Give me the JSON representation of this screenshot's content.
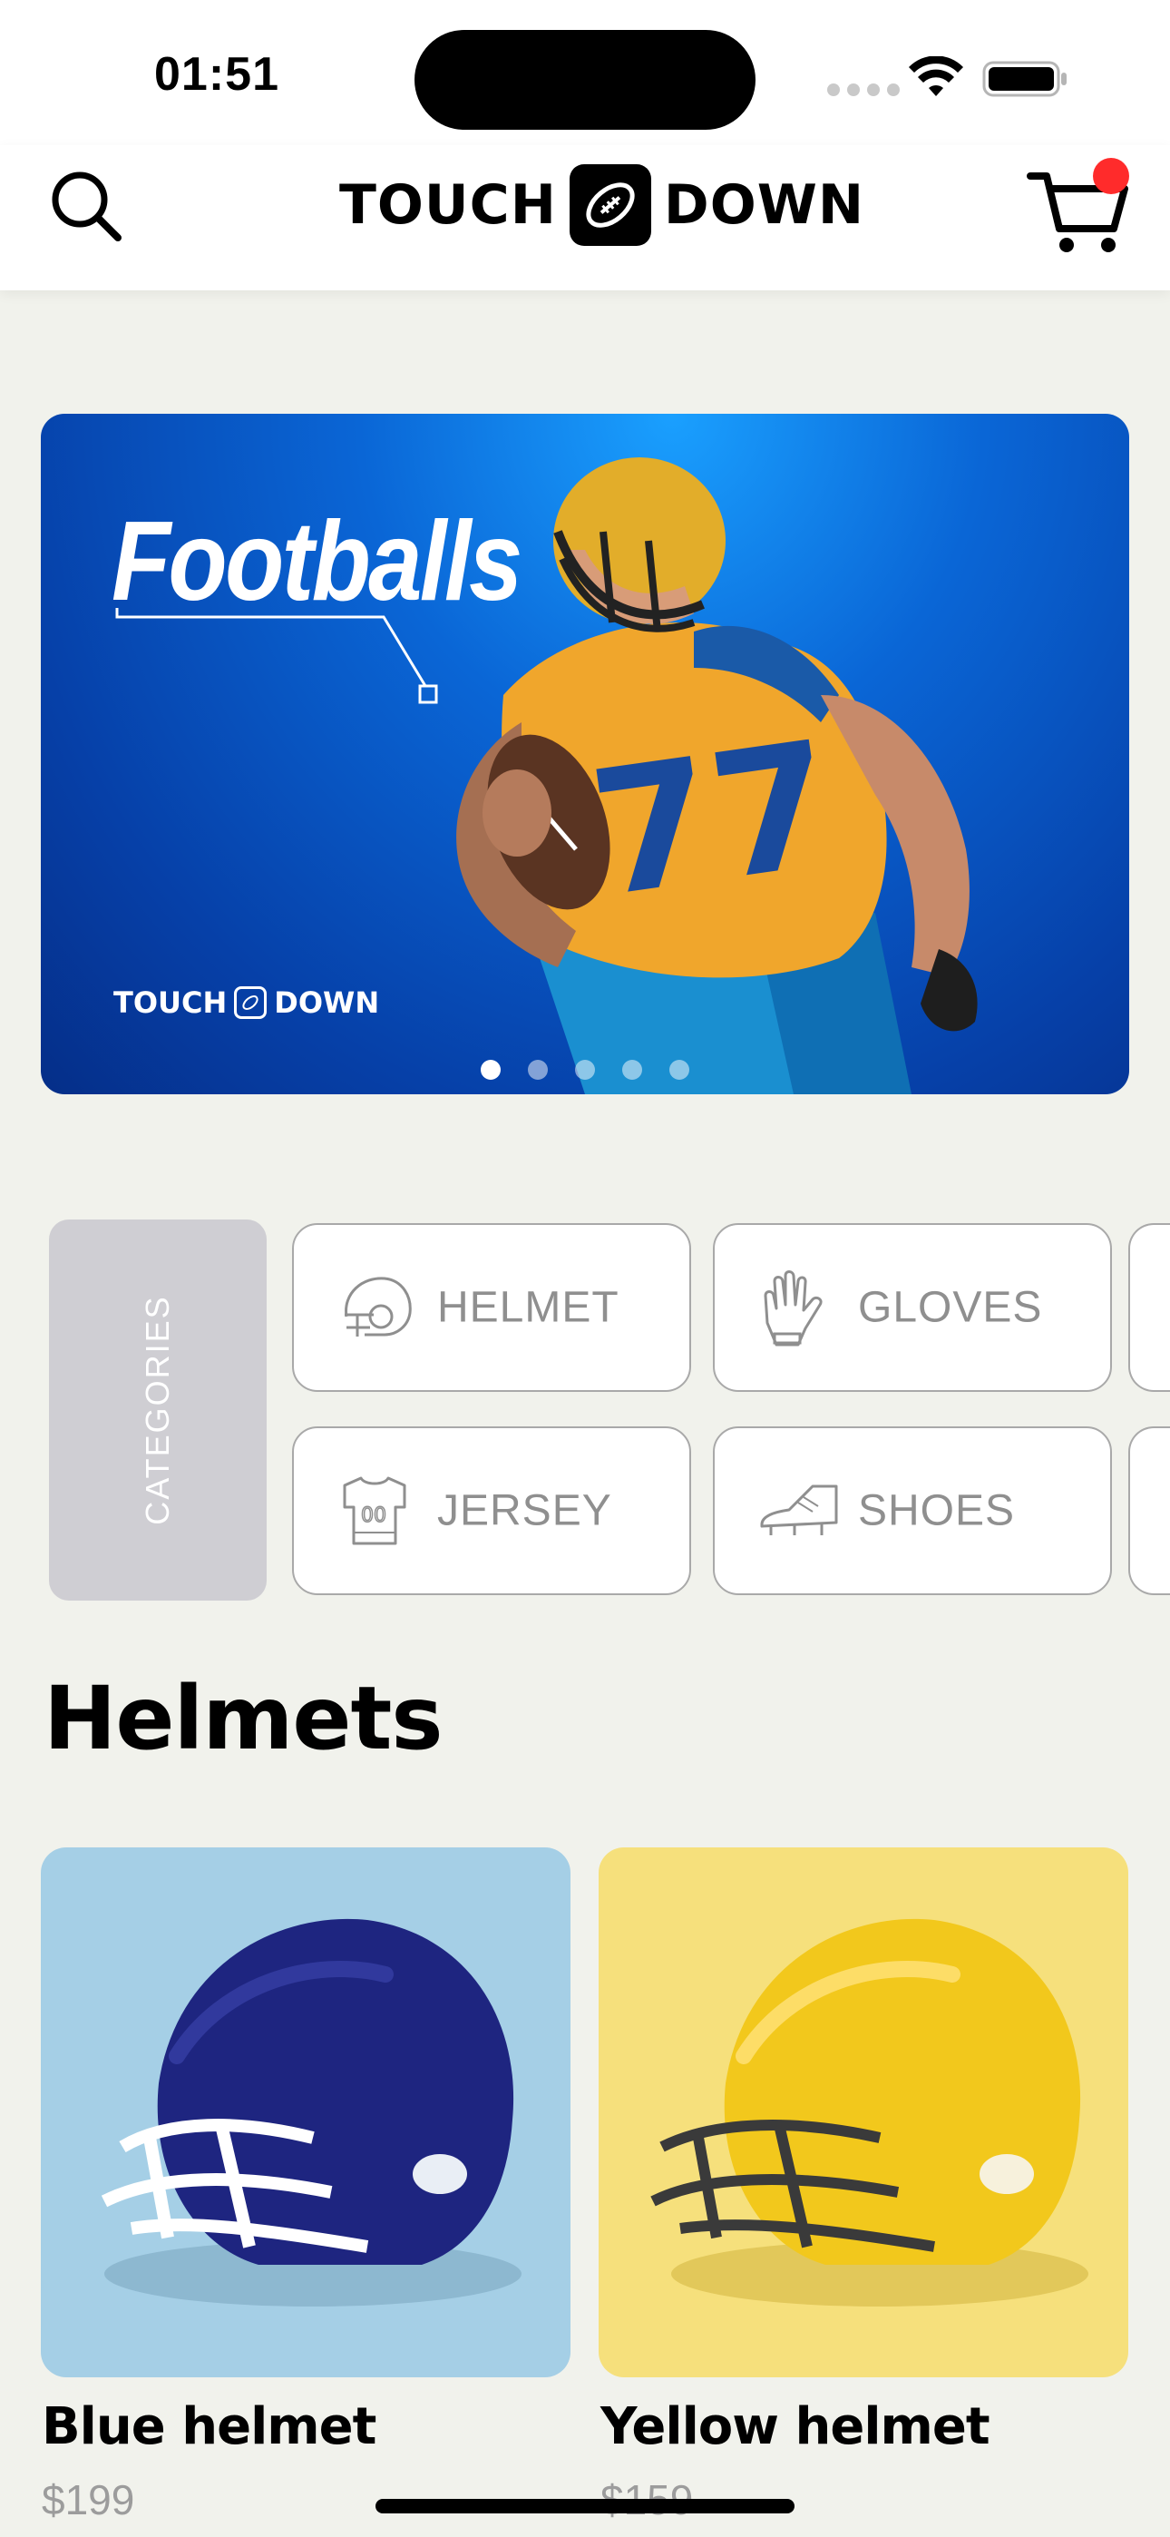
{
  "status_bar": {
    "time": "01:51"
  },
  "header": {
    "logo_left": "TOUCH",
    "logo_right": "DOWN",
    "search_icon": "search-icon",
    "cart_icon": "cart-icon",
    "cart_badge_color": "#ff2b2b"
  },
  "hero": {
    "title": "Footballs",
    "brand_left": "TOUCH",
    "brand_right": "DOWN",
    "slide_count": 5,
    "active_slide": 1,
    "background_color": "#0a66d6"
  },
  "categories": {
    "label": "CATEGORIES",
    "items": [
      {
        "label": "HELMET",
        "icon": "helmet-icon"
      },
      {
        "label": "GLOVES",
        "icon": "gloves-icon"
      },
      {
        "label": "JERSEY",
        "icon": "jersey-icon"
      },
      {
        "label": "SHOES",
        "icon": "shoes-icon"
      }
    ]
  },
  "helmets": {
    "title": "Helmets",
    "products": [
      {
        "name": "Blue helmet",
        "price": "$199",
        "card_color": "#a5cfe6",
        "helmet_color": "#1e2580"
      },
      {
        "name": "Yellow helmet",
        "price": "$159",
        "card_color": "#f6e07c",
        "helmet_color": "#f2c81c"
      }
    ]
  }
}
